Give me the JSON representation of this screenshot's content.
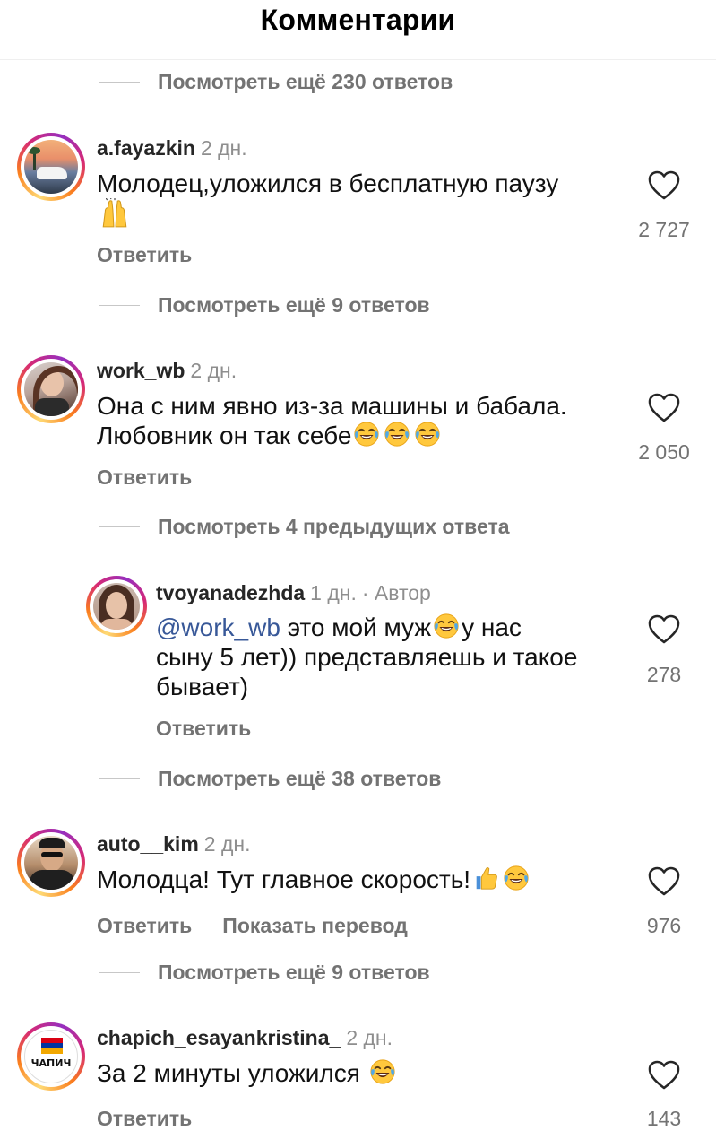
{
  "header": {
    "title": "Комментарии"
  },
  "threads": [
    {
      "more_label": "Посмотреть ещё 230 ответов"
    },
    {
      "more_label": "Посмотреть ещё 9 ответов"
    },
    {
      "more_label": "Посмотреть 4 предыдущих ответа"
    },
    {
      "more_label": "Посмотреть ещё 38 ответов"
    },
    {
      "more_label": "Посмотреть ещё 9 ответов"
    }
  ],
  "comments": [
    {
      "username": "a.fayazkin",
      "time": "2 дн.",
      "text": "Молодец,уложился в бесплатную паузу",
      "emojis": [
        "raising-hands-emoji"
      ],
      "reply_label": "Ответить",
      "likes": "2 727"
    },
    {
      "username": "work_wb",
      "time": "2 дн.",
      "text_line1": "Она с ним явно из-за машины и бабала.",
      "text_line2": "Любовник он так себе",
      "emojis": [
        "laughing-emoji",
        "laughing-emoji",
        "laughing-emoji"
      ],
      "reply_label": "Ответить",
      "likes": "2 050"
    },
    {
      "username": "tvoyanadezhda",
      "time": "1 дн.",
      "author_tag": "· Автор",
      "mention": "@work_wb",
      "text_part1": "это мой муж",
      "text_part2": "у нас",
      "text_line2": "сыну 5 лет)) представляешь и такое",
      "text_line3": "бывает)",
      "emojis": [
        "laughing-emoji"
      ],
      "reply_label": "Ответить",
      "likes": "278"
    },
    {
      "username": "auto__kim",
      "time": "2 дн.",
      "text": "Молодца! Тут главное скорость!",
      "emojis": [
        "thumbs-up-emoji",
        "laughing-emoji"
      ],
      "reply_label": "Ответить",
      "translate_label": "Показать перевод",
      "likes": "976"
    },
    {
      "username": "chapich_esayankristina_",
      "time": "2 дн.",
      "text": "За 2 минуты уложился",
      "avatar_text": "ЧАПИЧ",
      "emojis": [
        "laughing-emoji"
      ],
      "reply_label": "Ответить",
      "likes": "143"
    }
  ],
  "colors": {
    "secondary_text": "#737373",
    "meta_text": "#8e8e8e",
    "mention": "#385898",
    "ring_gradient": [
      "#feda75",
      "#fa7e1e",
      "#d62976",
      "#962fbf"
    ]
  },
  "icons": [
    "heart-outline-icon",
    "laughing-emoji",
    "raising-hands-emoji",
    "thumbs-up-emoji",
    "armenian-flag"
  ]
}
